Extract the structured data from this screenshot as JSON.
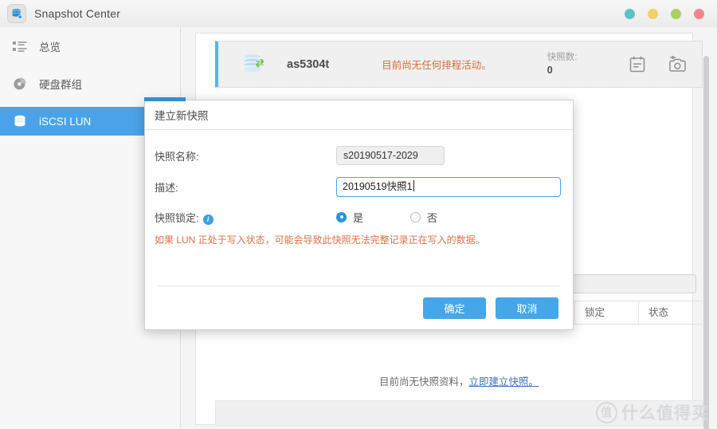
{
  "window": {
    "app_icon": "database-stack-icon",
    "title": "Snapshot Center",
    "controls": [
      {
        "name": "window-dot-teal",
        "color": "#5cc3c3"
      },
      {
        "name": "window-dot-yellow",
        "color": "#f2d06b"
      },
      {
        "name": "window-dot-green",
        "color": "#a9d161"
      },
      {
        "name": "window-dot-red",
        "color": "#f4848c"
      }
    ]
  },
  "sidebar": {
    "items": [
      {
        "label": "总览",
        "icon": "list-overview-icon",
        "active": false
      },
      {
        "label": "硬盘群组",
        "icon": "pie-chart-icon",
        "active": false
      },
      {
        "label": "iSCSI LUN",
        "icon": "database-stack-icon",
        "active": true
      }
    ],
    "active_color": "#4aa3e8"
  },
  "device": {
    "icon": "database-sync-icon",
    "name": "as5304t",
    "schedule_status": "目前尚无任何排程活动。",
    "snapshot_count_label": "快照数:",
    "snapshot_count_value": "0",
    "tools": [
      {
        "name": "schedule-calendar-icon",
        "label": "排程"
      },
      {
        "name": "take-snapshot-camera-icon",
        "label": "建立快照"
      }
    ],
    "schedule_color": "#d9693a"
  },
  "table": {
    "columns": [
      "锁定",
      "状态"
    ],
    "empty_text": "目前尚无快照资料，",
    "empty_link": "立即建立快照。"
  },
  "dialog": {
    "title": "建立新快照",
    "fields": {
      "name_label": "快照名称:",
      "name_value": "s20190517-2029",
      "desc_label": "描述:",
      "desc_value": "20190519快照1",
      "desc_placeholder": "",
      "lock_label": "快照锁定:",
      "lock_info_icon": "info-icon",
      "lock_yes": "是",
      "lock_no": "否",
      "lock_selected": "是"
    },
    "warning": "如果 LUN 正处于写入状态，可能会导致此快照无法完整记录正在写入的数据。",
    "warning_color": "#e0714a",
    "ok_label": "确定",
    "cancel_label": "取消",
    "button_color": "#45a6e8"
  },
  "watermark": {
    "mark": "值",
    "text": "什么值得买"
  }
}
